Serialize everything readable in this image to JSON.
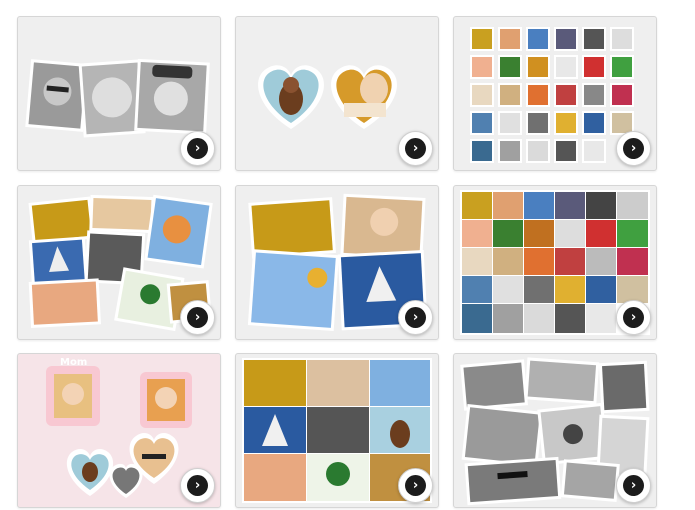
{
  "gallery": {
    "items": [
      {
        "id": "tilted-three",
        "style": "tilted-photos"
      },
      {
        "id": "two-hearts",
        "style": "heart-frames"
      },
      {
        "id": "scattered-squares",
        "style": "scattered-grid"
      },
      {
        "id": "pinwheel-collage",
        "style": "scattered-collage"
      },
      {
        "id": "four-tilted",
        "style": "tilted-photos"
      },
      {
        "id": "photo-grid",
        "style": "grid"
      },
      {
        "id": "mom-hearts",
        "style": "heart-frames",
        "label": "Mom"
      },
      {
        "id": "nine-grid",
        "style": "grid"
      },
      {
        "id": "bw-collage",
        "style": "scattered-collage"
      }
    ],
    "button_icon": "chevron-right-icon",
    "button_glyph": "›",
    "accent": "#1c1c1c",
    "card_bg": "#efefef"
  }
}
